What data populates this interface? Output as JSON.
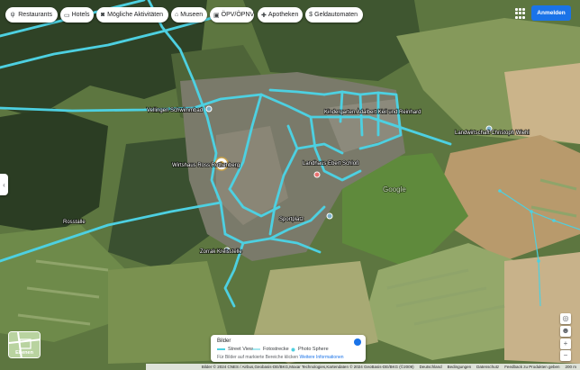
{
  "toolbar": {
    "categories": [
      {
        "label": "Restaurants",
        "icon": "fork-knife-icon"
      },
      {
        "label": "Hotels",
        "icon": "bed-icon"
      },
      {
        "label": "Mögliche Aktivitäten",
        "icon": "camera-icon"
      },
      {
        "label": "Museen",
        "icon": "museum-icon"
      },
      {
        "label": "ÖPV/ÖPNV",
        "icon": "bus-icon"
      },
      {
        "label": "Apotheken",
        "icon": "pharmacy-icon"
      },
      {
        "label": "Geldautomaten",
        "icon": "atm-icon"
      }
    ],
    "signin_label": "Anmelden"
  },
  "map": {
    "labels": [
      "Vellingen Schwimmbad",
      "Wirtshaus Ross Rothenberg",
      "Kindergarten Adalbert Keil und Reinhard",
      "Landhaus Ebert Schloß",
      "Landwirtschaft Christoph Wiehl",
      "Zorrak Kreisstelle",
      "Sportplatz",
      "Rosstalle",
      "Google"
    ],
    "accent_color": "#4dd0e1"
  },
  "layers_button": {
    "label": "Ebenen"
  },
  "legend": {
    "title": "Bilder",
    "items": [
      {
        "label": "Street View"
      },
      {
        "label": "Fotostrecke"
      },
      {
        "label": "Photo Sphere"
      }
    ],
    "subtitle_prefix": "Für Bilder auf markierte Bereiche klicken",
    "subtitle_link": "Weitere Informationen"
  },
  "footer": {
    "items": [
      "Bilder © 2024 CNES / Airbus,Geobasis-DE/BKG,Maxar Technologies,Kartendaten © 2024 GeoBasis-DE/BKG (©2009)",
      "Deutschland",
      "Bedingungen",
      "Datenschutz",
      "Feedback zu Produkten geben",
      "200 m"
    ]
  }
}
